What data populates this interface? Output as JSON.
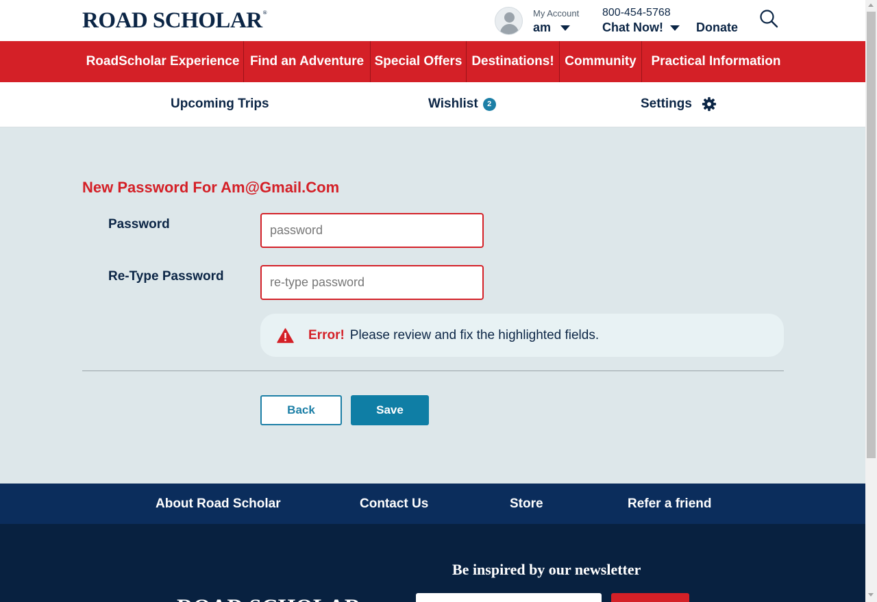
{
  "header": {
    "logo": "ROAD SCHOLAR",
    "logo_mark": "®",
    "account_label": "My Account",
    "account_user": "am",
    "phone": "800-454-5768",
    "chat": "Chat Now!",
    "donate": "Donate"
  },
  "main_nav": [
    {
      "label": "RoadScholar Experience"
    },
    {
      "label": "Find an Adventure"
    },
    {
      "label": "Special Offers"
    },
    {
      "label": "Destinations!"
    },
    {
      "label": "Community"
    },
    {
      "label": "Practical Information"
    }
  ],
  "account_nav": {
    "upcoming": "Upcoming Trips",
    "wishlist": "Wishlist",
    "wishlist_count": "2",
    "settings": "Settings"
  },
  "form": {
    "title": "New Password For Am@Gmail.Com",
    "password_label": "Password",
    "password_placeholder": "password",
    "password_value": "",
    "retype_label": "Re-Type Password",
    "retype_placeholder": "re-type password",
    "retype_value": "",
    "error_strong": "Error!",
    "error_message": "Please review and fix the highlighted fields.",
    "back_label": "Back",
    "save_label": "Save"
  },
  "footer_nav": [
    {
      "label": "About Road Scholar"
    },
    {
      "label": "Contact Us"
    },
    {
      "label": "Store"
    },
    {
      "label": "Refer a friend"
    }
  ],
  "footer": {
    "newsletter_title": "Be inspired by our newsletter",
    "logo": "ROAD SCHOLAR"
  },
  "colors": {
    "brand_red": "#d42027",
    "navy": "#0b2545",
    "teal": "#1c7fa6",
    "panel_bg": "#dde7ea",
    "footer_navy": "#0b2d5c"
  },
  "icons": [
    "avatar-icon",
    "caret-down-icon",
    "search-icon",
    "gear-icon",
    "warning-icon"
  ]
}
